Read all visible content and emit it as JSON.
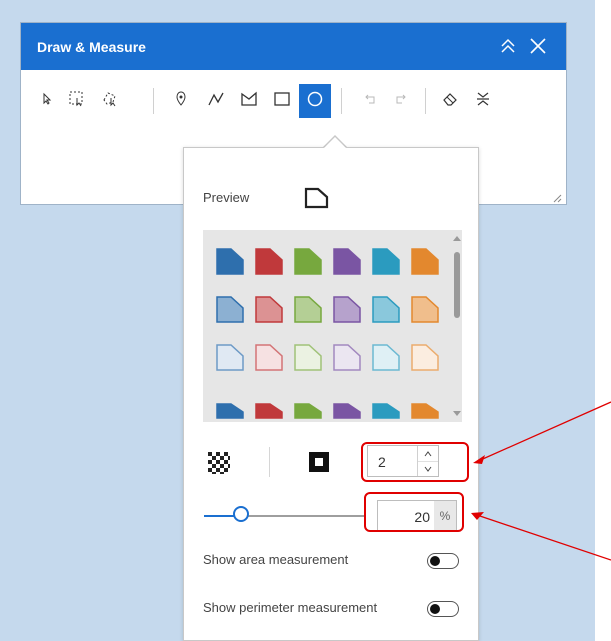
{
  "widget": {
    "title": "Draw & Measure",
    "colors": {
      "header": "#1a6fd0",
      "map": "#c5d9ed",
      "annotation": "#e00000"
    },
    "title_icons": [
      "collapse-icon",
      "close-icon"
    ],
    "tools": [
      {
        "name": "select-tool",
        "icon": "pointer-icon",
        "active": false
      },
      {
        "name": "box-select-tool",
        "icon": "box-select-icon",
        "active": false
      },
      {
        "name": "lasso-select-tool",
        "icon": "lasso-select-icon",
        "active": false
      },
      {
        "name": "point-tool",
        "icon": "point-icon",
        "active": false
      },
      {
        "name": "polyline-tool",
        "icon": "polyline-icon",
        "active": false
      },
      {
        "name": "polygon-tool",
        "icon": "polygon-icon",
        "active": false
      },
      {
        "name": "rectangle-tool",
        "icon": "rectangle-icon",
        "active": false
      },
      {
        "name": "circle-tool",
        "icon": "circle-icon",
        "active": true
      },
      {
        "name": "undo-button",
        "icon": "undo-icon",
        "active": false
      },
      {
        "name": "redo-button",
        "icon": "redo-icon",
        "active": false
      },
      {
        "name": "eraser-button",
        "icon": "eraser-icon",
        "active": false
      },
      {
        "name": "settings-button",
        "icon": "settings-icon",
        "active": false
      }
    ]
  },
  "popup": {
    "preview_label": "Preview",
    "gallery": {
      "palette": [
        "#2e6fad",
        "#c0393b",
        "#77a83e",
        "#7a55a3",
        "#2b9bbf",
        "#e3882e"
      ],
      "fill_styles": [
        "solid",
        "light",
        "outline",
        "bottom-solid"
      ]
    },
    "outline_width": "2",
    "opacity_value": "20",
    "opacity_unit": "%",
    "opacity_level": 0.2,
    "toggles": [
      {
        "label": "Show area measurement",
        "on": false
      },
      {
        "label": "Show perimeter measurement",
        "on": false
      }
    ]
  }
}
